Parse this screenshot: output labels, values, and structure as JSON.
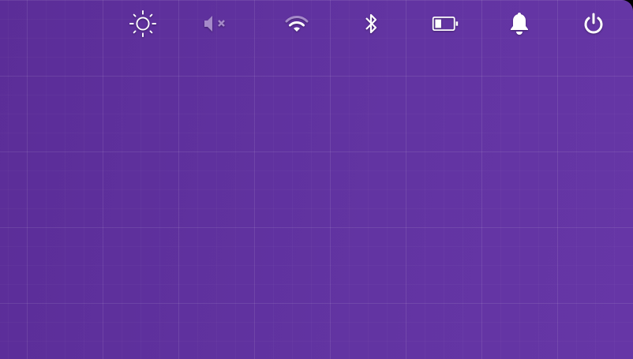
{
  "tray": {
    "icons": [
      {
        "name": "night-light-icon",
        "state": "on"
      },
      {
        "name": "volume-muted-icon",
        "state": "muted"
      },
      {
        "name": "wifi-icon",
        "signal": "medium"
      },
      {
        "name": "bluetooth-icon",
        "state": "on"
      },
      {
        "name": "battery-icon",
        "level_percent": 35
      },
      {
        "name": "notification-bell-icon"
      },
      {
        "name": "power-icon"
      }
    ]
  },
  "colors": {
    "background": "#6234a2",
    "icon": "#ffffff",
    "icon_dim": "#a58ac9"
  }
}
